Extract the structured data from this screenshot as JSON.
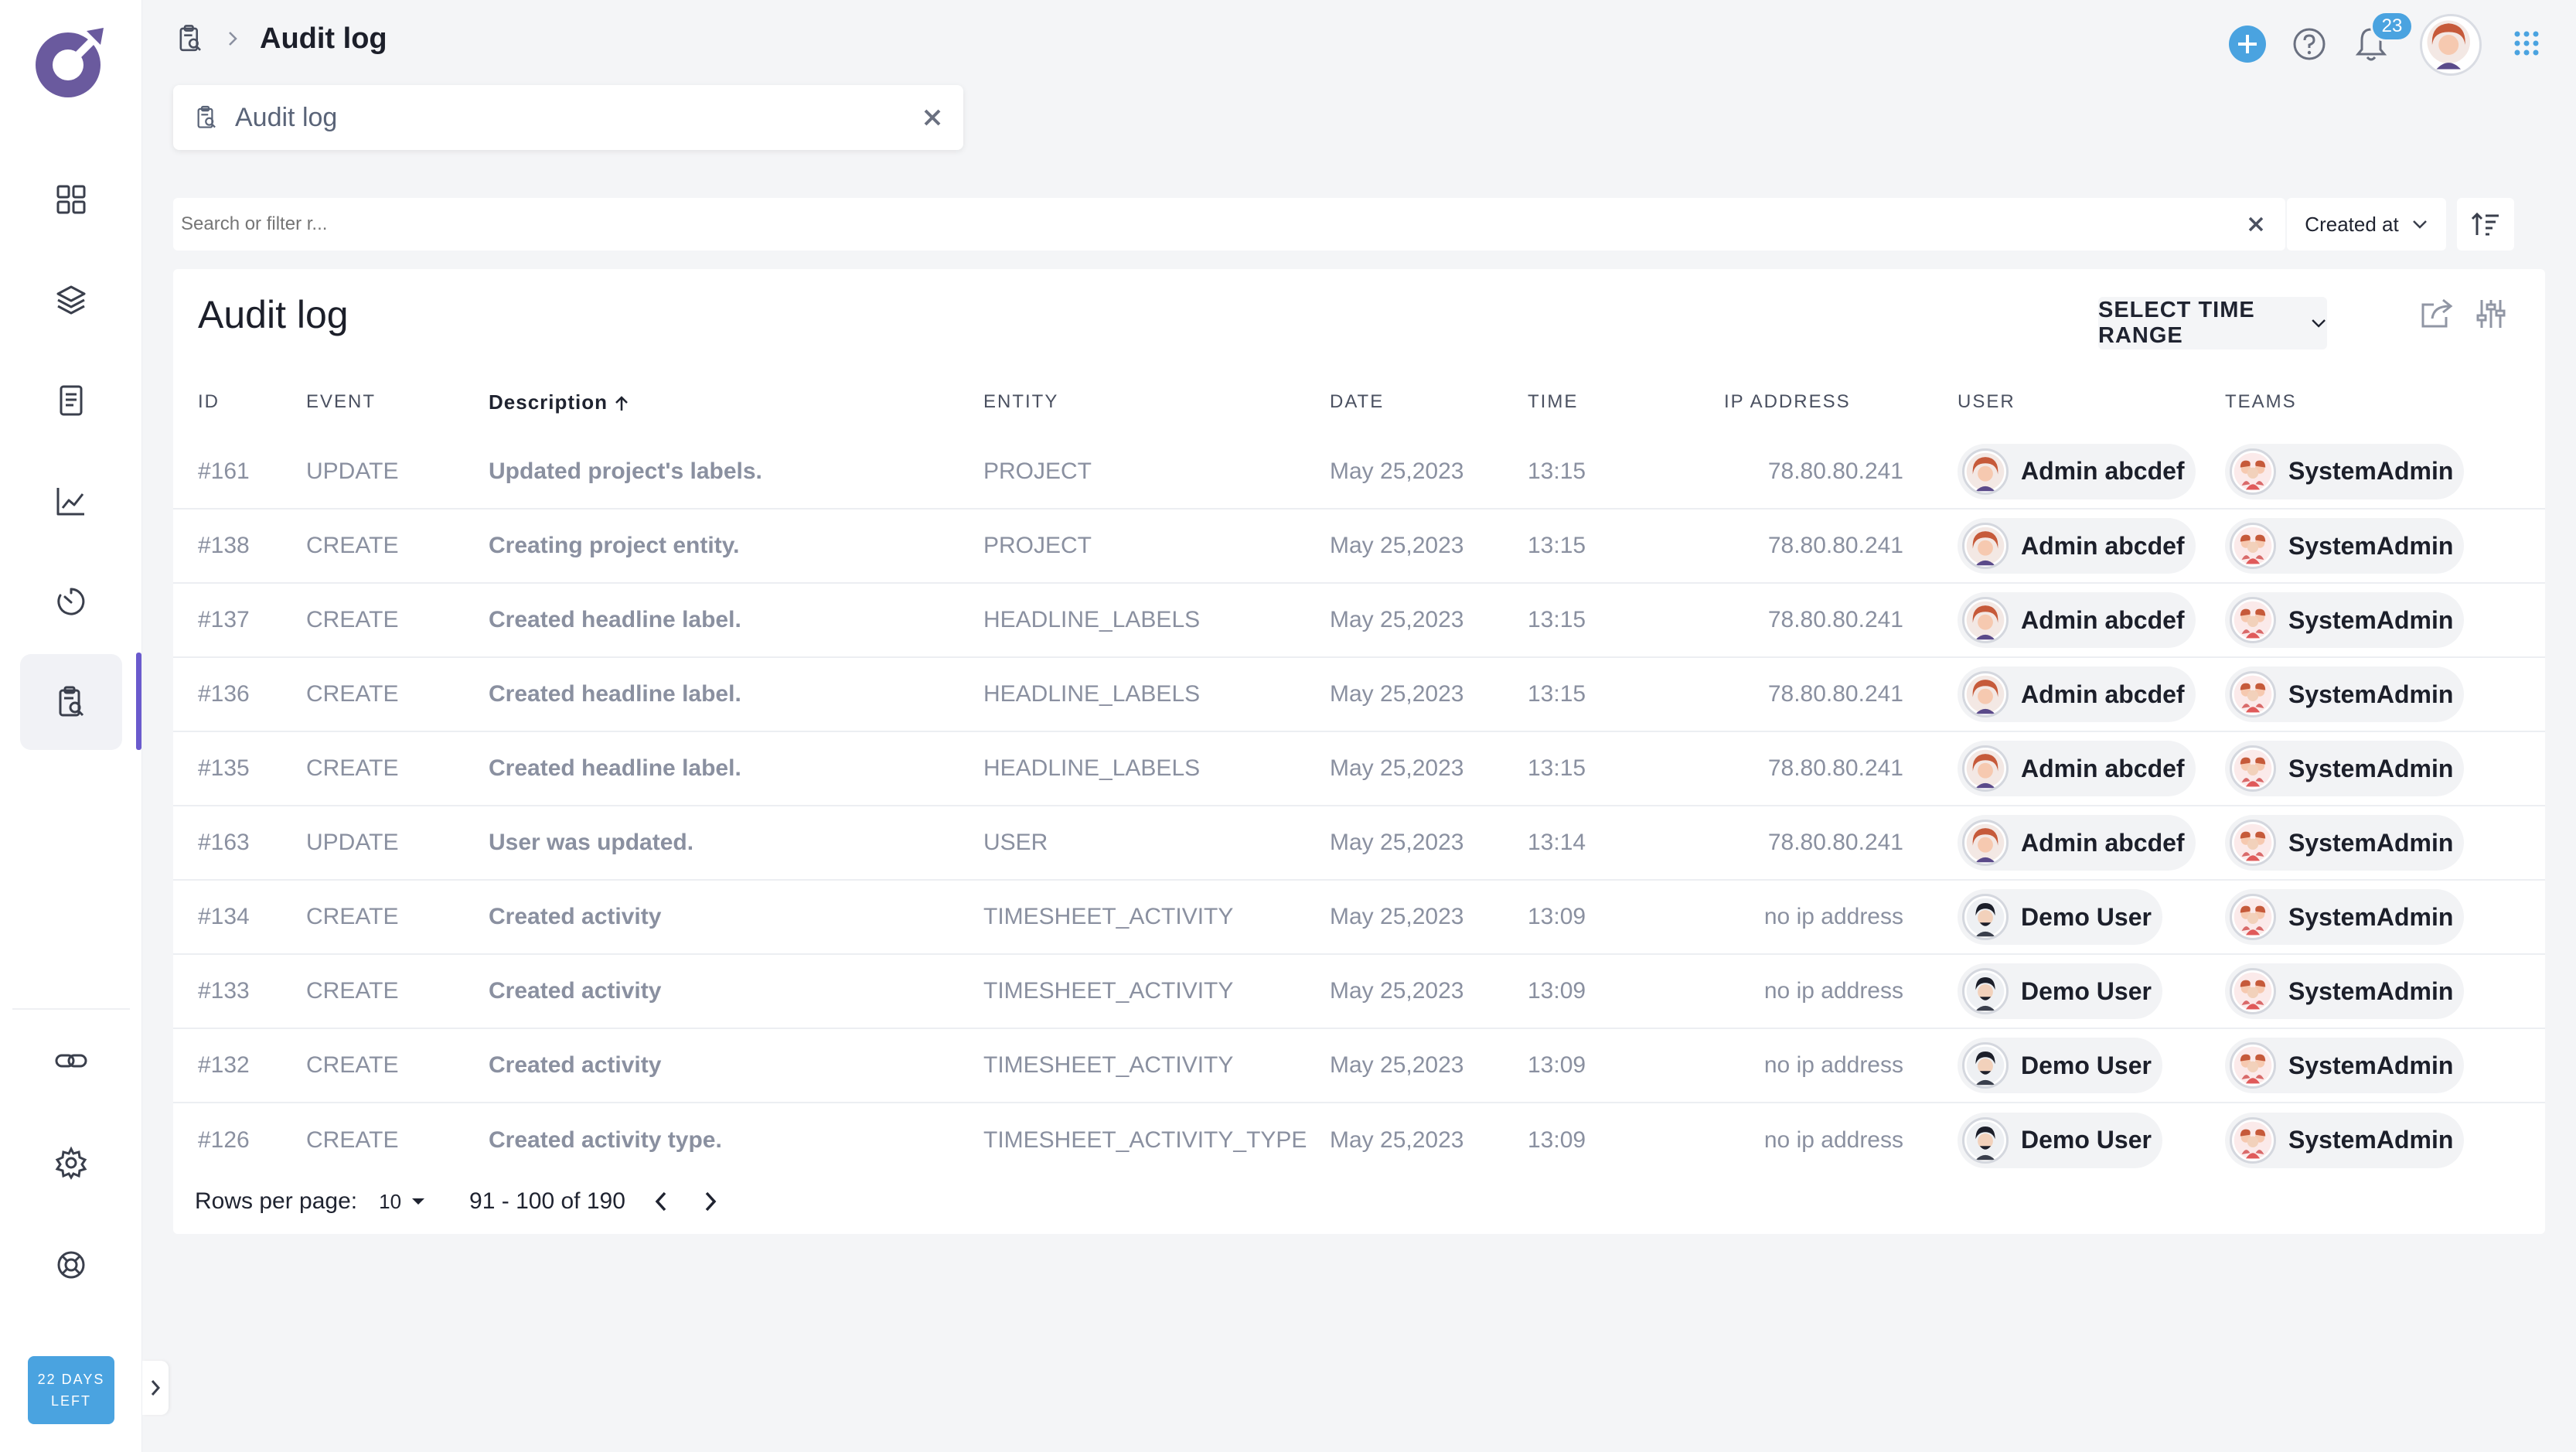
{
  "header": {
    "title": "Audit log",
    "notification_count": "23"
  },
  "tab": {
    "label": "Audit log"
  },
  "search": {
    "placeholder": "Search or filter r..."
  },
  "sort": {
    "label": "Created at"
  },
  "card": {
    "title": "Audit log",
    "range_button": "SELECT TIME RANGE"
  },
  "table": {
    "columns": {
      "id": "ID",
      "event": "EVENT",
      "description": "Description",
      "entity": "ENTITY",
      "date": "DATE",
      "time": "TIME",
      "ip": "IP ADDRESS",
      "user": "USER",
      "teams": "TEAMS"
    },
    "rows": [
      {
        "id": "#161",
        "event": "UPDATE",
        "description": "Updated project's labels.",
        "entity": "PROJECT",
        "date": "May 25,2023",
        "time": "13:15",
        "ip": "78.80.80.241",
        "user": "Admin abcdef",
        "team": "SystemAdmin"
      },
      {
        "id": "#138",
        "event": "CREATE",
        "description": "Creating project entity.",
        "entity": "PROJECT",
        "date": "May 25,2023",
        "time": "13:15",
        "ip": "78.80.80.241",
        "user": "Admin abcdef",
        "team": "SystemAdmin"
      },
      {
        "id": "#137",
        "event": "CREATE",
        "description": "Created headline label.",
        "entity": "HEADLINE_LABELS",
        "date": "May 25,2023",
        "time": "13:15",
        "ip": "78.80.80.241",
        "user": "Admin abcdef",
        "team": "SystemAdmin"
      },
      {
        "id": "#136",
        "event": "CREATE",
        "description": "Created headline label.",
        "entity": "HEADLINE_LABELS",
        "date": "May 25,2023",
        "time": "13:15",
        "ip": "78.80.80.241",
        "user": "Admin abcdef",
        "team": "SystemAdmin"
      },
      {
        "id": "#135",
        "event": "CREATE",
        "description": "Created headline label.",
        "entity": "HEADLINE_LABELS",
        "date": "May 25,2023",
        "time": "13:15",
        "ip": "78.80.80.241",
        "user": "Admin abcdef",
        "team": "SystemAdmin"
      },
      {
        "id": "#163",
        "event": "UPDATE",
        "description": "User was updated.",
        "entity": "USER",
        "date": "May 25,2023",
        "time": "13:14",
        "ip": "78.80.80.241",
        "user": "Admin abcdef",
        "team": "SystemAdmin"
      },
      {
        "id": "#134",
        "event": "CREATE",
        "description": "Created activity",
        "entity": "TIMESHEET_ACTIVITY",
        "date": "May 25,2023",
        "time": "13:09",
        "ip": "no ip address",
        "user": "Demo User",
        "team": "SystemAdmin"
      },
      {
        "id": "#133",
        "event": "CREATE",
        "description": "Created activity",
        "entity": "TIMESHEET_ACTIVITY",
        "date": "May 25,2023",
        "time": "13:09",
        "ip": "no ip address",
        "user": "Demo User",
        "team": "SystemAdmin"
      },
      {
        "id": "#132",
        "event": "CREATE",
        "description": "Created activity",
        "entity": "TIMESHEET_ACTIVITY",
        "date": "May 25,2023",
        "time": "13:09",
        "ip": "no ip address",
        "user": "Demo User",
        "team": "SystemAdmin"
      },
      {
        "id": "#126",
        "event": "CREATE",
        "description": "Created activity type.",
        "entity": "TIMESHEET_ACTIVITY_TYPE",
        "date": "May 25,2023",
        "time": "13:09",
        "ip": "no ip address",
        "user": "Demo User",
        "team": "SystemAdmin"
      }
    ]
  },
  "pagination": {
    "rows_per_page_label": "Rows per page:",
    "rows_per_page_value": "10",
    "range": "91 - 100 of 190"
  },
  "sidebar": {
    "trial": {
      "line1": "22 DAYS",
      "line2": "LEFT"
    }
  },
  "colors": {
    "accent": "#6a5acd",
    "primary_blue": "#4aa3e0",
    "background": "#f4f5f7"
  }
}
